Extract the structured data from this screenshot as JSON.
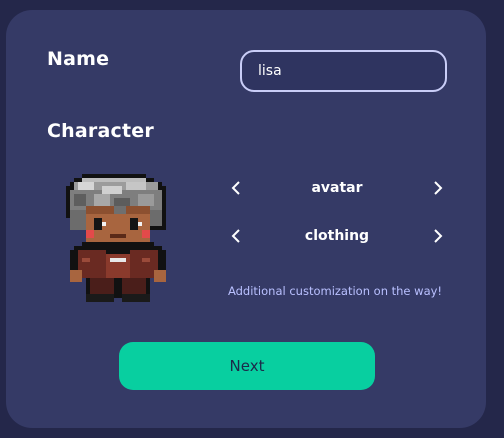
{
  "form": {
    "name_label": "Name",
    "name_value": "lisa",
    "character_label": "Character"
  },
  "selectors": [
    {
      "label": "avatar"
    },
    {
      "label": "clothing"
    }
  ],
  "note": "Additional customization on the way!",
  "next_button": "Next",
  "icons": {
    "prev": "chevron-left-icon",
    "next": "chevron-right-icon"
  },
  "colors": {
    "background": "#24274a",
    "card": "#353a66",
    "accent": "#08cfa0",
    "note_text": "#b9c0ff",
    "input_border": "#c9cdf7"
  }
}
